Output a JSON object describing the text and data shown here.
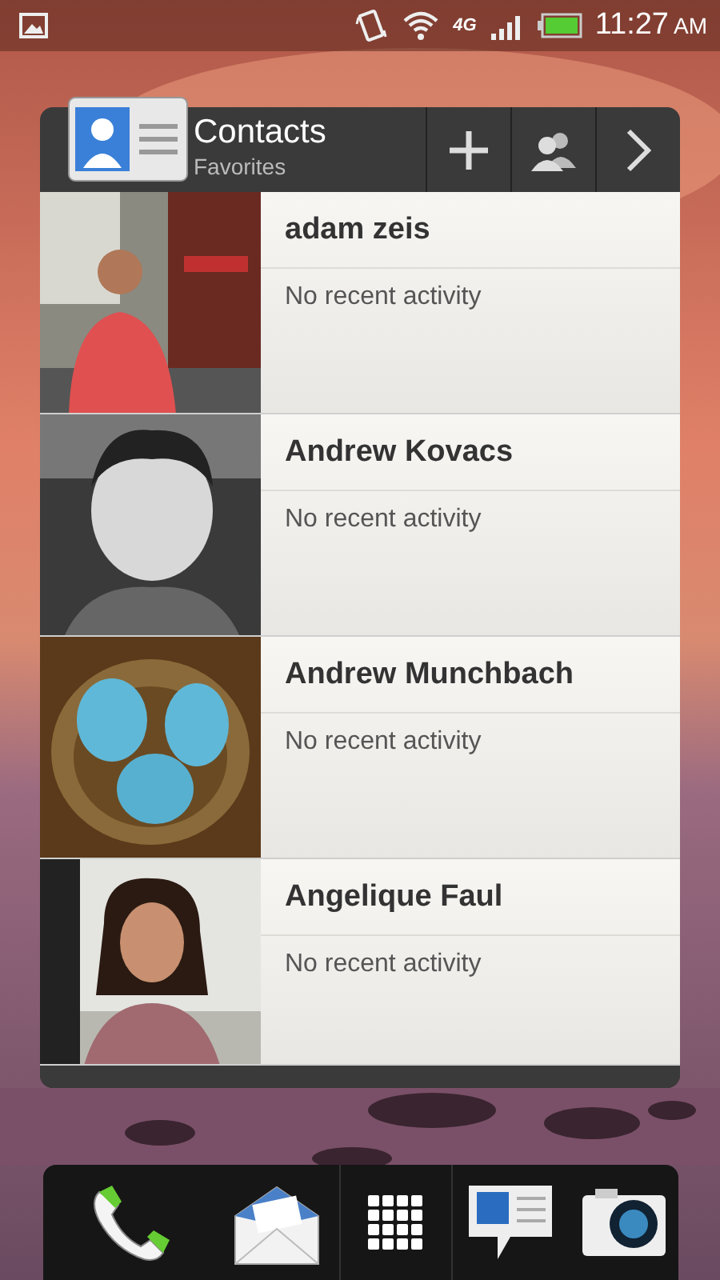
{
  "status_bar": {
    "network": "4G",
    "time": "11:27",
    "am_pm": "AM"
  },
  "widget": {
    "title": "Contacts",
    "subtitle": "Favorites",
    "contacts": [
      {
        "name": "adam zeis",
        "activity": "No recent activity"
      },
      {
        "name": "Andrew Kovacs",
        "activity": "No recent activity"
      },
      {
        "name": "Andrew Munchbach",
        "activity": "No recent activity"
      },
      {
        "name": "Angelique Faul",
        "activity": "No recent activity"
      }
    ]
  }
}
